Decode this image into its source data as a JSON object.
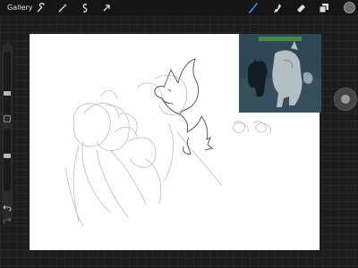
{
  "app": {
    "gallery_label": "Gallery"
  },
  "toolbar_left": [
    {
      "icon": "wrench-icon",
      "name": "actions"
    },
    {
      "icon": "magic-wand-icon",
      "name": "adjustments"
    },
    {
      "icon": "selection-icon",
      "name": "selection"
    },
    {
      "icon": "arrow-cursor-icon",
      "name": "transform"
    }
  ],
  "toolbar_right": [
    {
      "icon": "brush-icon",
      "name": "brush",
      "active": true
    },
    {
      "icon": "smudge-icon",
      "name": "smudge",
      "active": false
    },
    {
      "icon": "eraser-icon",
      "name": "eraser",
      "active": false
    },
    {
      "icon": "layers-icon",
      "name": "layers",
      "active": false
    }
  ],
  "colors": {
    "active_tool": "#3b82f6",
    "current_color": "#6b6b6b",
    "canvas": "#ffffff",
    "sketch": "#bdbdbd",
    "lineart": "#5a5a5a"
  },
  "brush": {
    "size_level": 0.33,
    "opacity_level": 0.57
  },
  "sidebar": {
    "undo_icon": "undo-icon",
    "redo_icon": "redo-icon"
  },
  "reference": {
    "caption_visible": true
  }
}
